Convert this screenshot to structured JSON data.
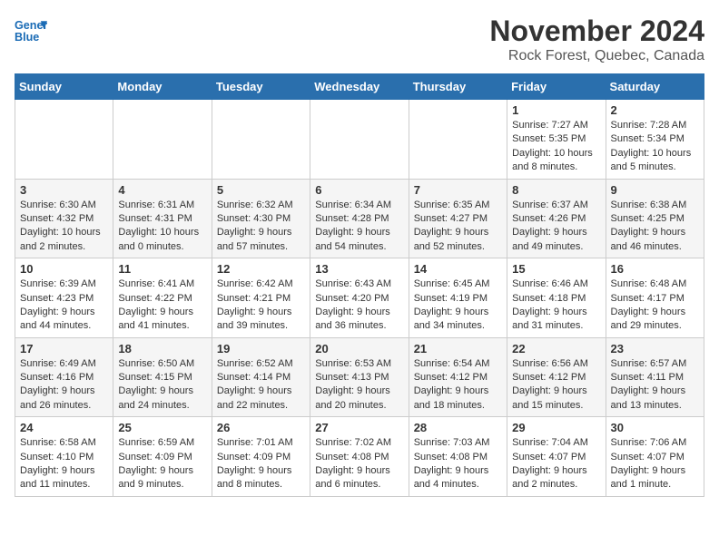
{
  "header": {
    "logo_line1": "General",
    "logo_line2": "Blue",
    "title": "November 2024",
    "subtitle": "Rock Forest, Quebec, Canada"
  },
  "weekdays": [
    "Sunday",
    "Monday",
    "Tuesday",
    "Wednesday",
    "Thursday",
    "Friday",
    "Saturday"
  ],
  "weeks": [
    [
      {
        "day": "",
        "info": ""
      },
      {
        "day": "",
        "info": ""
      },
      {
        "day": "",
        "info": ""
      },
      {
        "day": "",
        "info": ""
      },
      {
        "day": "",
        "info": ""
      },
      {
        "day": "1",
        "info": "Sunrise: 7:27 AM\nSunset: 5:35 PM\nDaylight: 10 hours and 8 minutes."
      },
      {
        "day": "2",
        "info": "Sunrise: 7:28 AM\nSunset: 5:34 PM\nDaylight: 10 hours and 5 minutes."
      }
    ],
    [
      {
        "day": "3",
        "info": "Sunrise: 6:30 AM\nSunset: 4:32 PM\nDaylight: 10 hours and 2 minutes."
      },
      {
        "day": "4",
        "info": "Sunrise: 6:31 AM\nSunset: 4:31 PM\nDaylight: 10 hours and 0 minutes."
      },
      {
        "day": "5",
        "info": "Sunrise: 6:32 AM\nSunset: 4:30 PM\nDaylight: 9 hours and 57 minutes."
      },
      {
        "day": "6",
        "info": "Sunrise: 6:34 AM\nSunset: 4:28 PM\nDaylight: 9 hours and 54 minutes."
      },
      {
        "day": "7",
        "info": "Sunrise: 6:35 AM\nSunset: 4:27 PM\nDaylight: 9 hours and 52 minutes."
      },
      {
        "day": "8",
        "info": "Sunrise: 6:37 AM\nSunset: 4:26 PM\nDaylight: 9 hours and 49 minutes."
      },
      {
        "day": "9",
        "info": "Sunrise: 6:38 AM\nSunset: 4:25 PM\nDaylight: 9 hours and 46 minutes."
      }
    ],
    [
      {
        "day": "10",
        "info": "Sunrise: 6:39 AM\nSunset: 4:23 PM\nDaylight: 9 hours and 44 minutes."
      },
      {
        "day": "11",
        "info": "Sunrise: 6:41 AM\nSunset: 4:22 PM\nDaylight: 9 hours and 41 minutes."
      },
      {
        "day": "12",
        "info": "Sunrise: 6:42 AM\nSunset: 4:21 PM\nDaylight: 9 hours and 39 minutes."
      },
      {
        "day": "13",
        "info": "Sunrise: 6:43 AM\nSunset: 4:20 PM\nDaylight: 9 hours and 36 minutes."
      },
      {
        "day": "14",
        "info": "Sunrise: 6:45 AM\nSunset: 4:19 PM\nDaylight: 9 hours and 34 minutes."
      },
      {
        "day": "15",
        "info": "Sunrise: 6:46 AM\nSunset: 4:18 PM\nDaylight: 9 hours and 31 minutes."
      },
      {
        "day": "16",
        "info": "Sunrise: 6:48 AM\nSunset: 4:17 PM\nDaylight: 9 hours and 29 minutes."
      }
    ],
    [
      {
        "day": "17",
        "info": "Sunrise: 6:49 AM\nSunset: 4:16 PM\nDaylight: 9 hours and 26 minutes."
      },
      {
        "day": "18",
        "info": "Sunrise: 6:50 AM\nSunset: 4:15 PM\nDaylight: 9 hours and 24 minutes."
      },
      {
        "day": "19",
        "info": "Sunrise: 6:52 AM\nSunset: 4:14 PM\nDaylight: 9 hours and 22 minutes."
      },
      {
        "day": "20",
        "info": "Sunrise: 6:53 AM\nSunset: 4:13 PM\nDaylight: 9 hours and 20 minutes."
      },
      {
        "day": "21",
        "info": "Sunrise: 6:54 AM\nSunset: 4:12 PM\nDaylight: 9 hours and 18 minutes."
      },
      {
        "day": "22",
        "info": "Sunrise: 6:56 AM\nSunset: 4:12 PM\nDaylight: 9 hours and 15 minutes."
      },
      {
        "day": "23",
        "info": "Sunrise: 6:57 AM\nSunset: 4:11 PM\nDaylight: 9 hours and 13 minutes."
      }
    ],
    [
      {
        "day": "24",
        "info": "Sunrise: 6:58 AM\nSunset: 4:10 PM\nDaylight: 9 hours and 11 minutes."
      },
      {
        "day": "25",
        "info": "Sunrise: 6:59 AM\nSunset: 4:09 PM\nDaylight: 9 hours and 9 minutes."
      },
      {
        "day": "26",
        "info": "Sunrise: 7:01 AM\nSunset: 4:09 PM\nDaylight: 9 hours and 8 minutes."
      },
      {
        "day": "27",
        "info": "Sunrise: 7:02 AM\nSunset: 4:08 PM\nDaylight: 9 hours and 6 minutes."
      },
      {
        "day": "28",
        "info": "Sunrise: 7:03 AM\nSunset: 4:08 PM\nDaylight: 9 hours and 4 minutes."
      },
      {
        "day": "29",
        "info": "Sunrise: 7:04 AM\nSunset: 4:07 PM\nDaylight: 9 hours and 2 minutes."
      },
      {
        "day": "30",
        "info": "Sunrise: 7:06 AM\nSunset: 4:07 PM\nDaylight: 9 hours and 1 minute."
      }
    ]
  ]
}
